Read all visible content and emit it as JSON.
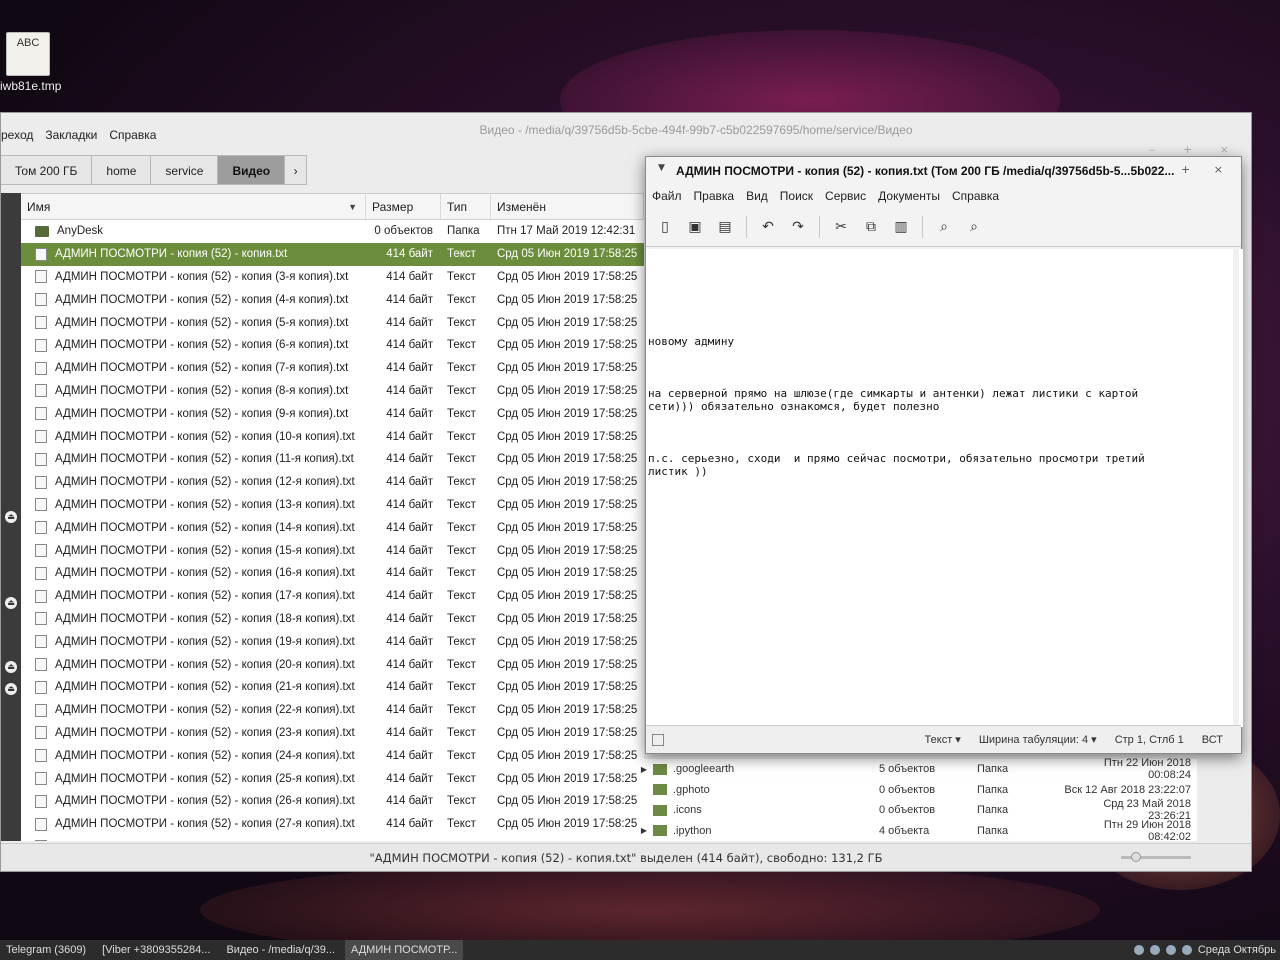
{
  "desktop": {
    "icon_badge": "ABC",
    "icon_label": "iwb81e.tmp"
  },
  "file_manager": {
    "title": "Видео - /media/q/39756d5b-5cbe-494f-99b7-c5b022597695/home/service/Видео",
    "menu": [
      "реход",
      "Закладки",
      "Справка"
    ],
    "breadcrumbs": [
      "Том 200 ГБ",
      "home",
      "service",
      "Видео"
    ],
    "columns": {
      "name": "Имя",
      "size": "Размер",
      "type": "Тип",
      "modified": "Изменён"
    },
    "rows": [
      {
        "name": "AnyDesk",
        "size": "0 объектов",
        "type": "Папка",
        "modified": "Птн 17 Май 2019 12:42:31",
        "kind": "folder"
      },
      {
        "name": "АДМИН ПОСМОТРИ - копия (52) - копия.txt",
        "size": "414 байт",
        "type": "Текст",
        "modified": "Срд 05 Июн 2019 17:58:25",
        "kind": "file",
        "selected": true
      },
      {
        "name": "АДМИН ПОСМОТРИ - копия (52) - копия (3-я копия).txt",
        "size": "414 байт",
        "type": "Текст",
        "modified": "Срд 05 Июн 2019 17:58:25",
        "kind": "file"
      },
      {
        "name": "АДМИН ПОСМОТРИ - копия (52) - копия (4-я копия).txt",
        "size": "414 байт",
        "type": "Текст",
        "modified": "Срд 05 Июн 2019 17:58:25",
        "kind": "file"
      },
      {
        "name": "АДМИН ПОСМОТРИ - копия (52) - копия (5-я копия).txt",
        "size": "414 байт",
        "type": "Текст",
        "modified": "Срд 05 Июн 2019 17:58:25",
        "kind": "file"
      },
      {
        "name": "АДМИН ПОСМОТРИ - копия (52) - копия (6-я копия).txt",
        "size": "414 байт",
        "type": "Текст",
        "modified": "Срд 05 Июн 2019 17:58:25",
        "kind": "file"
      },
      {
        "name": "АДМИН ПОСМОТРИ - копия (52) - копия (7-я копия).txt",
        "size": "414 байт",
        "type": "Текст",
        "modified": "Срд 05 Июн 2019 17:58:25",
        "kind": "file"
      },
      {
        "name": "АДМИН ПОСМОТРИ - копия (52) - копия (8-я копия).txt",
        "size": "414 байт",
        "type": "Текст",
        "modified": "Срд 05 Июн 2019 17:58:25",
        "kind": "file"
      },
      {
        "name": "АДМИН ПОСМОТРИ - копия (52) - копия (9-я копия).txt",
        "size": "414 байт",
        "type": "Текст",
        "modified": "Срд 05 Июн 2019 17:58:25",
        "kind": "file"
      },
      {
        "name": "АДМИН ПОСМОТРИ - копия (52) - копия (10-я копия).txt",
        "size": "414 байт",
        "type": "Текст",
        "modified": "Срд 05 Июн 2019 17:58:25",
        "kind": "file"
      },
      {
        "name": "АДМИН ПОСМОТРИ - копия (52) - копия (11-я копия).txt",
        "size": "414 байт",
        "type": "Текст",
        "modified": "Срд 05 Июн 2019 17:58:25",
        "kind": "file"
      },
      {
        "name": "АДМИН ПОСМОТРИ - копия (52) - копия (12-я копия).txt",
        "size": "414 байт",
        "type": "Текст",
        "modified": "Срд 05 Июн 2019 17:58:25",
        "kind": "file"
      },
      {
        "name": "АДМИН ПОСМОТРИ - копия (52) - копия (13-я копия).txt",
        "size": "414 байт",
        "type": "Текст",
        "modified": "Срд 05 Июн 2019 17:58:25",
        "kind": "file"
      },
      {
        "name": "АДМИН ПОСМОТРИ - копия (52) - копия (14-я копия).txt",
        "size": "414 байт",
        "type": "Текст",
        "modified": "Срд 05 Июн 2019 17:58:25",
        "kind": "file"
      },
      {
        "name": "АДМИН ПОСМОТРИ - копия (52) - копия (15-я копия).txt",
        "size": "414 байт",
        "type": "Текст",
        "modified": "Срд 05 Июн 2019 17:58:25",
        "kind": "file"
      },
      {
        "name": "АДМИН ПОСМОТРИ - копия (52) - копия (16-я копия).txt",
        "size": "414 байт",
        "type": "Текст",
        "modified": "Срд 05 Июн 2019 17:58:25",
        "kind": "file"
      },
      {
        "name": "АДМИН ПОСМОТРИ - копия (52) - копия (17-я копия).txt",
        "size": "414 байт",
        "type": "Текст",
        "modified": "Срд 05 Июн 2019 17:58:25",
        "kind": "file"
      },
      {
        "name": "АДМИН ПОСМОТРИ - копия (52) - копия (18-я копия).txt",
        "size": "414 байт",
        "type": "Текст",
        "modified": "Срд 05 Июн 2019 17:58:25",
        "kind": "file"
      },
      {
        "name": "АДМИН ПОСМОТРИ - копия (52) - копия (19-я копия).txt",
        "size": "414 байт",
        "type": "Текст",
        "modified": "Срд 05 Июн 2019 17:58:25",
        "kind": "file"
      },
      {
        "name": "АДМИН ПОСМОТРИ - копия (52) - копия (20-я копия).txt",
        "size": "414 байт",
        "type": "Текст",
        "modified": "Срд 05 Июн 2019 17:58:25",
        "kind": "file"
      },
      {
        "name": "АДМИН ПОСМОТРИ - копия (52) - копия (21-я копия).txt",
        "size": "414 байт",
        "type": "Текст",
        "modified": "Срд 05 Июн 2019 17:58:25",
        "kind": "file"
      },
      {
        "name": "АДМИН ПОСМОТРИ - копия (52) - копия (22-я копия).txt",
        "size": "414 байт",
        "type": "Текст",
        "modified": "Срд 05 Июн 2019 17:58:25",
        "kind": "file"
      },
      {
        "name": "АДМИН ПОСМОТРИ - копия (52) - копия (23-я копия).txt",
        "size": "414 байт",
        "type": "Текст",
        "modified": "Срд 05 Июн 2019 17:58:25",
        "kind": "file"
      },
      {
        "name": "АДМИН ПОСМОТРИ - копия (52) - копия (24-я копия).txt",
        "size": "414 байт",
        "type": "Текст",
        "modified": "Срд 05 Июн 2019 17:58:25",
        "kind": "file"
      },
      {
        "name": "АДМИН ПОСМОТРИ - копия (52) - копия (25-я копия).txt",
        "size": "414 байт",
        "type": "Текст",
        "modified": "Срд 05 Июн 2019 17:58:25",
        "kind": "file"
      },
      {
        "name": "АДМИН ПОСМОТРИ - копия (52) - копия (26-я копия).txt",
        "size": "414 байт",
        "type": "Текст",
        "modified": "Срд 05 Июн 2019 17:58:25",
        "kind": "file"
      },
      {
        "name": "АДМИН ПОСМОТРИ - копия (52) - копия (27-я копия).txt",
        "size": "414 байт",
        "type": "Текст",
        "modified": "Срд 05 Июн 2019 17:58:25",
        "kind": "file"
      },
      {
        "name": "АДМИН ПОСМОТРИ - копия (52) - копия (28-я копия).txt",
        "size": "414 байт",
        "type": "Текст",
        "modified": "Срд 05 Июн 2019 17:58:25",
        "kind": "file"
      }
    ],
    "right_rows": [
      {
        "name": ".googleearth",
        "count": "5 объектов",
        "type": "Папка",
        "modified": "Птн 22 Июн 2018 00:08:24",
        "expandable": true
      },
      {
        "name": ".gphoto",
        "count": "0 объектов",
        "type": "Папка",
        "modified": "Вск 12 Авг 2018 23:22:07",
        "expandable": false
      },
      {
        "name": ".icons",
        "count": "0 объектов",
        "type": "Папка",
        "modified": "Срд 23 Май 2018 23:26:21",
        "expandable": false
      },
      {
        "name": ".ipython",
        "count": "4 объекта",
        "type": "Папка",
        "modified": "Птн 29 Июн 2018 08:42:02",
        "expandable": true
      }
    ],
    "status": "\"АДМИН ПОСМОТРИ - копия (52) - копия.txt\" выделен (414 байт), свободно: 131,2 ГБ",
    "selection_color": "#6c8e3c"
  },
  "editor": {
    "title": "АДМИН ПОСМОТРИ - копия (52) - копия.txt (Том 200 ГБ /media/q/39756d5b-5...5b022...",
    "menu": [
      "Файл",
      "Правка",
      "Вид",
      "Поиск",
      "Сервис",
      "Документы",
      "Справка"
    ],
    "content": {
      "line1": "новому админу",
      "line2": "на серверной прямо на шлюзе(где симкарты и антенки) лежат листики с картой\nсети))) обязательно ознакомся, будет полезно",
      "line3": "п.с. серьезно, сходи  и прямо сейчас посмотри, обязательно просмотри третий\nлистик ))"
    },
    "status": {
      "syntax": "Текст",
      "tab_width": "Ширина табуляции:  4",
      "position": "Стр 1, Стлб 1",
      "mode": "ВСТ"
    }
  },
  "taskbar": {
    "items": [
      "Telegram (3609)",
      "[Viber +3809355284...",
      "Видео - /media/q/39...",
      "АДМИН ПОСМОТР..."
    ],
    "clock": "Среда Октябрь"
  }
}
